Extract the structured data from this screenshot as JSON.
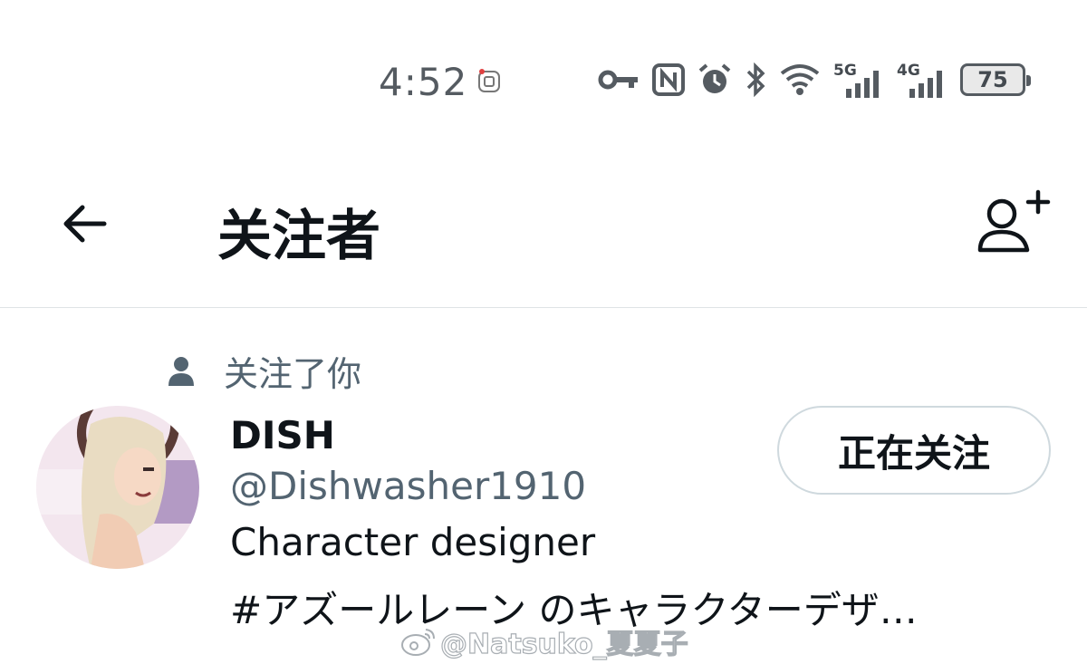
{
  "status_bar": {
    "time": "4:52",
    "net1": "5G",
    "net2": "4G",
    "battery": "75",
    "icons": [
      "app-notification-icon",
      "vpn-key-icon",
      "nfc-icon",
      "alarm-icon",
      "bluetooth-icon",
      "wifi-icon",
      "signal-5g-icon",
      "signal-4g-icon",
      "battery-icon"
    ]
  },
  "header": {
    "title": "关注者",
    "back_icon": "back-arrow-icon",
    "add_icon": "add-user-icon"
  },
  "follower": {
    "follows_you_label": "关注了你",
    "name": "DISH",
    "handle": "@Dishwasher1910",
    "bio_line1": "Character designer",
    "bio_line2": "#アズールレーン のキャラクターデザ…",
    "follow_button": "正在关注"
  },
  "watermark": {
    "text": "@Natsuko_夏夏子"
  },
  "colors": {
    "text_primary": "#0f1419",
    "text_secondary": "#536471",
    "divider": "#dfe3e6",
    "button_border": "#cfd9de"
  }
}
